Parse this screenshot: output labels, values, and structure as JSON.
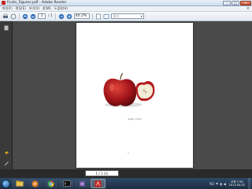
{
  "window": {
    "title": "Fruits_Figures.pdf - Adobe Reader",
    "controls": {
      "minimize": "–",
      "maximize": "□",
      "close": "✕"
    }
  },
  "menu": {
    "items": [
      "파일(F)",
      "편집(E)",
      "보기(V)",
      "창(W)",
      "도움말(H)"
    ],
    "close_glyph": "×"
  },
  "toolbar": {
    "current_page": "1",
    "total_pages": "/ 1",
    "zoom": "40.2%",
    "find_placeholder": "찾기",
    "accent": "#2d6bb5"
  },
  "document": {
    "caption": "Apple, 1 Slice",
    "page_mark": "1"
  },
  "status": {
    "page_tip": "1 / 1 (1)"
  },
  "taskbar": {
    "time": "오후 7:33",
    "date": "2013-04-02",
    "tray_language": "KO",
    "apps": [
      "explorer-icon",
      "media-player-icon",
      "chrome-icon",
      "terminal-icon",
      "visual-studio-icon",
      "adobe-reader-icon"
    ]
  }
}
